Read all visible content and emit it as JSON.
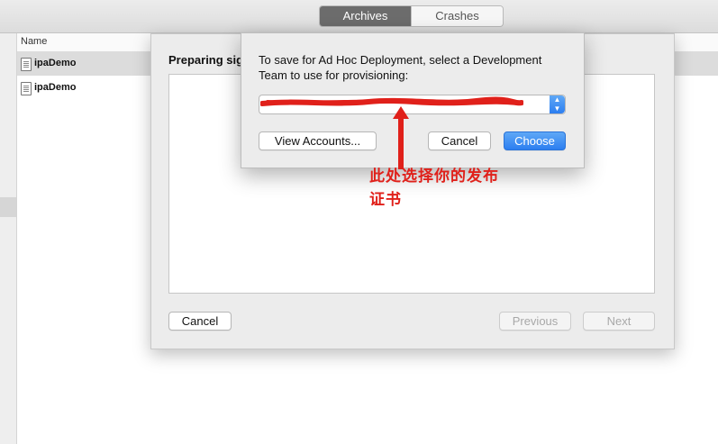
{
  "toolbar": {
    "tabs": [
      {
        "label": "Archives",
        "active": true
      },
      {
        "label": "Crashes",
        "active": false
      }
    ]
  },
  "list": {
    "header": "Name",
    "rows": [
      {
        "label": "ipaDemo",
        "selected": true
      },
      {
        "label": "ipaDemo",
        "selected": false
      }
    ]
  },
  "sheet": {
    "title": "Preparing sig",
    "cancel_label": "Cancel",
    "previous_label": "Previous",
    "next_label": "Next"
  },
  "dialog": {
    "message": "To save for Ad Hoc Deployment, select a Development Team to use for provisioning:",
    "team_value": "",
    "view_accounts_label": "View Accounts...",
    "cancel_label": "Cancel",
    "choose_label": "Choose"
  },
  "annotation": {
    "text": "此处选择你的发布证书",
    "color": "#e0201a"
  },
  "colors": {
    "accent": "#2c7ef0",
    "active_tab": "#6c6c6c"
  }
}
